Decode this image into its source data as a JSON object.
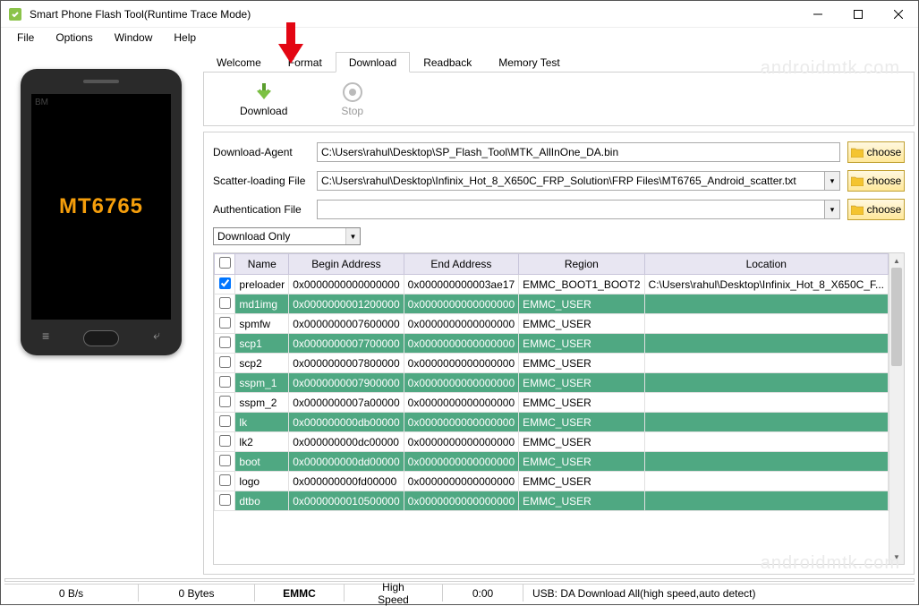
{
  "window": {
    "title": "Smart Phone Flash Tool(Runtime Trace Mode)",
    "chip": "MT6765",
    "bm": "BM"
  },
  "menu": {
    "file": "File",
    "options": "Options",
    "window": "Window",
    "help": "Help"
  },
  "tabs": {
    "welcome": "Welcome",
    "format": "Format",
    "download": "Download",
    "readback": "Readback",
    "memtest": "Memory Test"
  },
  "actions": {
    "download": "Download",
    "stop": "Stop"
  },
  "form": {
    "da_label": "Download-Agent",
    "da_value": "C:\\Users\\rahul\\Desktop\\SP_Flash_Tool\\MTK_AllInOne_DA.bin",
    "scatter_label": "Scatter-loading File",
    "scatter_value": "C:\\Users\\rahul\\Desktop\\Infinix_Hot_8_X650C_FRP_Solution\\FRP Files\\MT6765_Android_scatter.txt",
    "auth_label": "Authentication File",
    "auth_value": "",
    "choose": "choose",
    "mode": "Download Only"
  },
  "table": {
    "headers": {
      "name": "Name",
      "begin": "Begin Address",
      "end": "End Address",
      "region": "Region",
      "location": "Location"
    },
    "rows": [
      {
        "chk": true,
        "hl": false,
        "name": "preloader",
        "begin": "0x0000000000000000",
        "end": "0x000000000003ae17",
        "region": "EMMC_BOOT1_BOOT2",
        "location": "C:\\Users\\rahul\\Desktop\\Infinix_Hot_8_X650C_F..."
      },
      {
        "chk": false,
        "hl": true,
        "name": "md1img",
        "begin": "0x0000000001200000",
        "end": "0x0000000000000000",
        "region": "EMMC_USER",
        "location": ""
      },
      {
        "chk": false,
        "hl": false,
        "name": "spmfw",
        "begin": "0x0000000007600000",
        "end": "0x0000000000000000",
        "region": "EMMC_USER",
        "location": ""
      },
      {
        "chk": false,
        "hl": true,
        "name": "scp1",
        "begin": "0x0000000007700000",
        "end": "0x0000000000000000",
        "region": "EMMC_USER",
        "location": ""
      },
      {
        "chk": false,
        "hl": false,
        "name": "scp2",
        "begin": "0x0000000007800000",
        "end": "0x0000000000000000",
        "region": "EMMC_USER",
        "location": ""
      },
      {
        "chk": false,
        "hl": true,
        "name": "sspm_1",
        "begin": "0x0000000007900000",
        "end": "0x0000000000000000",
        "region": "EMMC_USER",
        "location": ""
      },
      {
        "chk": false,
        "hl": false,
        "name": "sspm_2",
        "begin": "0x0000000007a00000",
        "end": "0x0000000000000000",
        "region": "EMMC_USER",
        "location": ""
      },
      {
        "chk": false,
        "hl": true,
        "name": "lk",
        "begin": "0x000000000db00000",
        "end": "0x0000000000000000",
        "region": "EMMC_USER",
        "location": ""
      },
      {
        "chk": false,
        "hl": false,
        "name": "lk2",
        "begin": "0x000000000dc00000",
        "end": "0x0000000000000000",
        "region": "EMMC_USER",
        "location": ""
      },
      {
        "chk": false,
        "hl": true,
        "name": "boot",
        "begin": "0x000000000dd00000",
        "end": "0x0000000000000000",
        "region": "EMMC_USER",
        "location": ""
      },
      {
        "chk": false,
        "hl": false,
        "name": "logo",
        "begin": "0x000000000fd00000",
        "end": "0x0000000000000000",
        "region": "EMMC_USER",
        "location": ""
      },
      {
        "chk": false,
        "hl": true,
        "name": "dtbo",
        "begin": "0x0000000010500000",
        "end": "0x0000000000000000",
        "region": "EMMC_USER",
        "location": ""
      }
    ]
  },
  "status": {
    "speed": "0 B/s",
    "bytes": "0 Bytes",
    "storage": "EMMC",
    "usb_speed": "High Speed",
    "time": "0:00",
    "conn": "USB: DA Download All(high speed,auto detect)"
  },
  "watermark": "androidmtk.com"
}
